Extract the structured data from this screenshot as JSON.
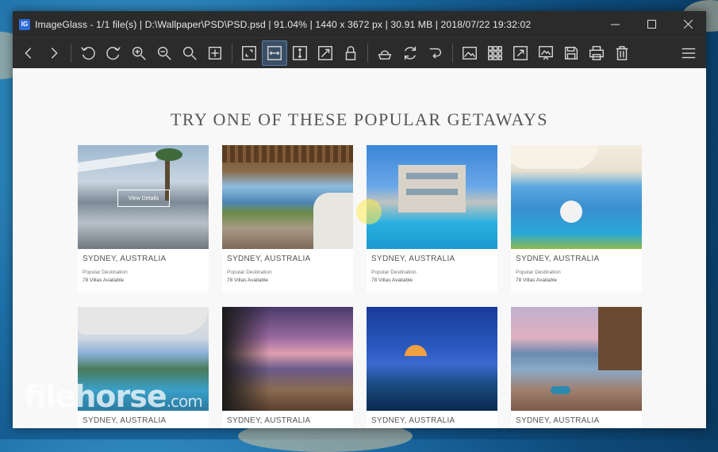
{
  "window": {
    "app_name": "ImageGlass",
    "title": "ImageGlass - 1/1 file(s)  |  D:\\Wallpaper\\PSD\\PSD.psd  |  91.04%  |  1440 x 3672 px  |  30.91 MB  |  2018/07/22 19:32:02",
    "icon_letter": "IG"
  },
  "toolbar": {
    "buttons": [
      {
        "name": "previous-image-button",
        "icon": "chevron-left-icon"
      },
      {
        "name": "next-image-button",
        "icon": "chevron-right-icon"
      },
      {
        "name": "rotate-left-button",
        "icon": "rotate-left-icon"
      },
      {
        "name": "rotate-right-button",
        "icon": "rotate-right-icon"
      },
      {
        "name": "zoom-in-button",
        "icon": "zoom-in-icon"
      },
      {
        "name": "zoom-out-button",
        "icon": "zoom-out-icon"
      },
      {
        "name": "zoom-to-fit-button",
        "icon": "search-icon"
      },
      {
        "name": "actual-size-button",
        "icon": "actual-size-icon"
      },
      {
        "name": "auto-zoom-button",
        "icon": "auto-zoom-icon"
      },
      {
        "name": "scale-to-width-button",
        "icon": "scale-width-icon"
      },
      {
        "name": "scale-to-height-button",
        "icon": "scale-height-icon"
      },
      {
        "name": "scale-to-fit-button",
        "icon": "scale-fit-icon"
      },
      {
        "name": "lock-zoom-button",
        "icon": "lock-icon"
      },
      {
        "name": "flip-button",
        "icon": "flip-icon"
      },
      {
        "name": "refresh-button",
        "icon": "refresh-icon"
      },
      {
        "name": "goto-button",
        "icon": "goto-icon"
      },
      {
        "name": "thumbnail-button",
        "icon": "image-icon"
      },
      {
        "name": "checkerboard-button",
        "icon": "grid-icon"
      },
      {
        "name": "fullscreen-button",
        "icon": "fullscreen-icon"
      },
      {
        "name": "slideshow-button",
        "icon": "slideshow-icon"
      },
      {
        "name": "save-button",
        "icon": "save-icon"
      },
      {
        "name": "print-button",
        "icon": "print-icon"
      },
      {
        "name": "delete-button",
        "icon": "trash-icon"
      }
    ],
    "active_button": "scale-to-width-button"
  },
  "page": {
    "heading": "TRY ONE OF THESE POPULAR GETAWAYS",
    "view_details_label": "View Details",
    "cards": [
      {
        "title": "SYDNEY, AUSTRALIA",
        "subtitle": "Popular Destination",
        "availability": "78 Villas Available"
      },
      {
        "title": "SYDNEY, AUSTRALIA",
        "subtitle": "Popular Destination",
        "availability": "78 Villas Available"
      },
      {
        "title": "SYDNEY, AUSTRALIA",
        "subtitle": "Popular Destination",
        "availability": "78 Villas Available"
      },
      {
        "title": "SYDNEY, AUSTRALIA",
        "subtitle": "Popular Destination",
        "availability": "78 Villas Available"
      },
      {
        "title": "SYDNEY, AUSTRALIA"
      },
      {
        "title": "SYDNEY, AUSTRALIA"
      },
      {
        "title": "SYDNEY, AUSTRALIA"
      },
      {
        "title": "SYDNEY, AUSTRALIA"
      }
    ]
  },
  "watermark": {
    "text": "filehorse",
    "suffix": ".com"
  },
  "colors": {
    "titlebar": "#2b2b2b",
    "active_button": "#3a4f66",
    "content_bg": "#f8f8f8"
  }
}
